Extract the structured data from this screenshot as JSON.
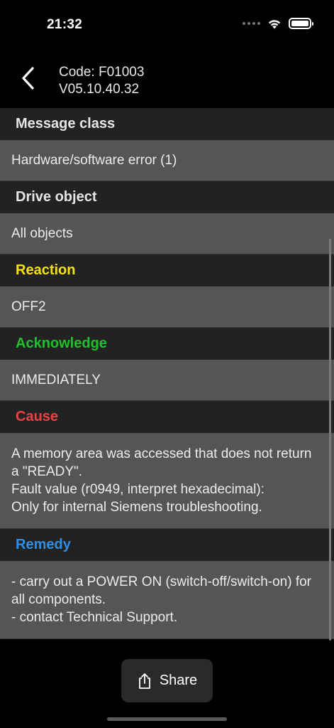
{
  "status": {
    "time": "21:32"
  },
  "header": {
    "code": "Code: F01003",
    "version": "V05.10.40.32"
  },
  "sections": [
    {
      "title": "Message class",
      "title_color": "#e6e6e6",
      "value": "Hardware/software error (1)"
    },
    {
      "title": "Drive object",
      "title_color": "#e6e6e6",
      "value": "All objects"
    },
    {
      "title": "Reaction",
      "title_color": "#f5e11a",
      "value": "OFF2"
    },
    {
      "title": "Acknowledge",
      "title_color": "#22c02e",
      "value": "IMMEDIATELY"
    },
    {
      "title": "Cause",
      "title_color": "#ee4242",
      "value_lines": [
        "A memory area was accessed that does not return a \"READY\".",
        "Fault value (r0949, interpret hexadecimal):",
        "Only for internal Siemens troubleshooting."
      ]
    },
    {
      "title": "Remedy",
      "title_color": "#2f8fe6",
      "value_lines": [
        "- carry out a POWER ON (switch-off/switch-on) for all components.",
        "- contact Technical Support."
      ]
    }
  ],
  "share_button": {
    "label": "Share",
    "icon": "share-icon"
  }
}
